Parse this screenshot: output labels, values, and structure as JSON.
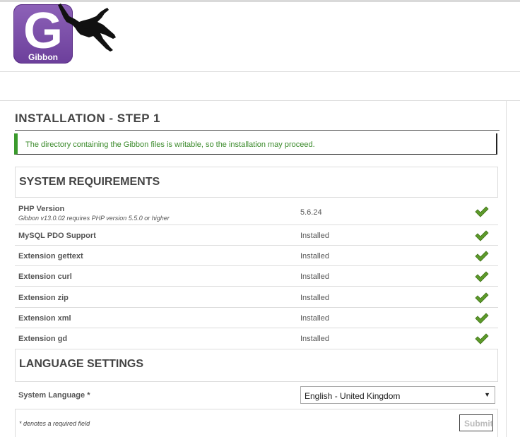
{
  "logo": {
    "letter": "G",
    "name": "Gibbon",
    "box_color": "#7b4fa8"
  },
  "page": {
    "title": "INSTALLATION - STEP 1"
  },
  "success_message": "The directory containing the Gibbon files is writable, so the installation may proceed.",
  "system_requirements": {
    "heading": "SYSTEM REQUIREMENTS",
    "rows": [
      {
        "label": "PHP Version",
        "sub": "Gibbon v13.0.02 requires PHP version 5.5.0 or higher",
        "value": "5.6.24",
        "status_icon": "check-icon"
      },
      {
        "label": "MySQL PDO Support",
        "sub": "",
        "value": "Installed",
        "status_icon": "check-icon"
      },
      {
        "label": "Extension gettext",
        "sub": "",
        "value": "Installed",
        "status_icon": "check-icon"
      },
      {
        "label": "Extension curl",
        "sub": "",
        "value": "Installed",
        "status_icon": "check-icon"
      },
      {
        "label": "Extension zip",
        "sub": "",
        "value": "Installed",
        "status_icon": "check-icon"
      },
      {
        "label": "Extension xml",
        "sub": "",
        "value": "Installed",
        "status_icon": "check-icon"
      },
      {
        "label": "Extension gd",
        "sub": "",
        "value": "Installed",
        "status_icon": "check-icon"
      }
    ]
  },
  "language_settings": {
    "heading": "LANGUAGE SETTINGS",
    "label": "System Language *",
    "selected": "English - United Kingdom"
  },
  "footer": {
    "required_note": "* denotes a required field",
    "submit_label": "Submit"
  },
  "colors": {
    "success_green": "#3a9a2c",
    "check_green": "#5d9a2a",
    "logo_purple": "#7b4fa8"
  }
}
